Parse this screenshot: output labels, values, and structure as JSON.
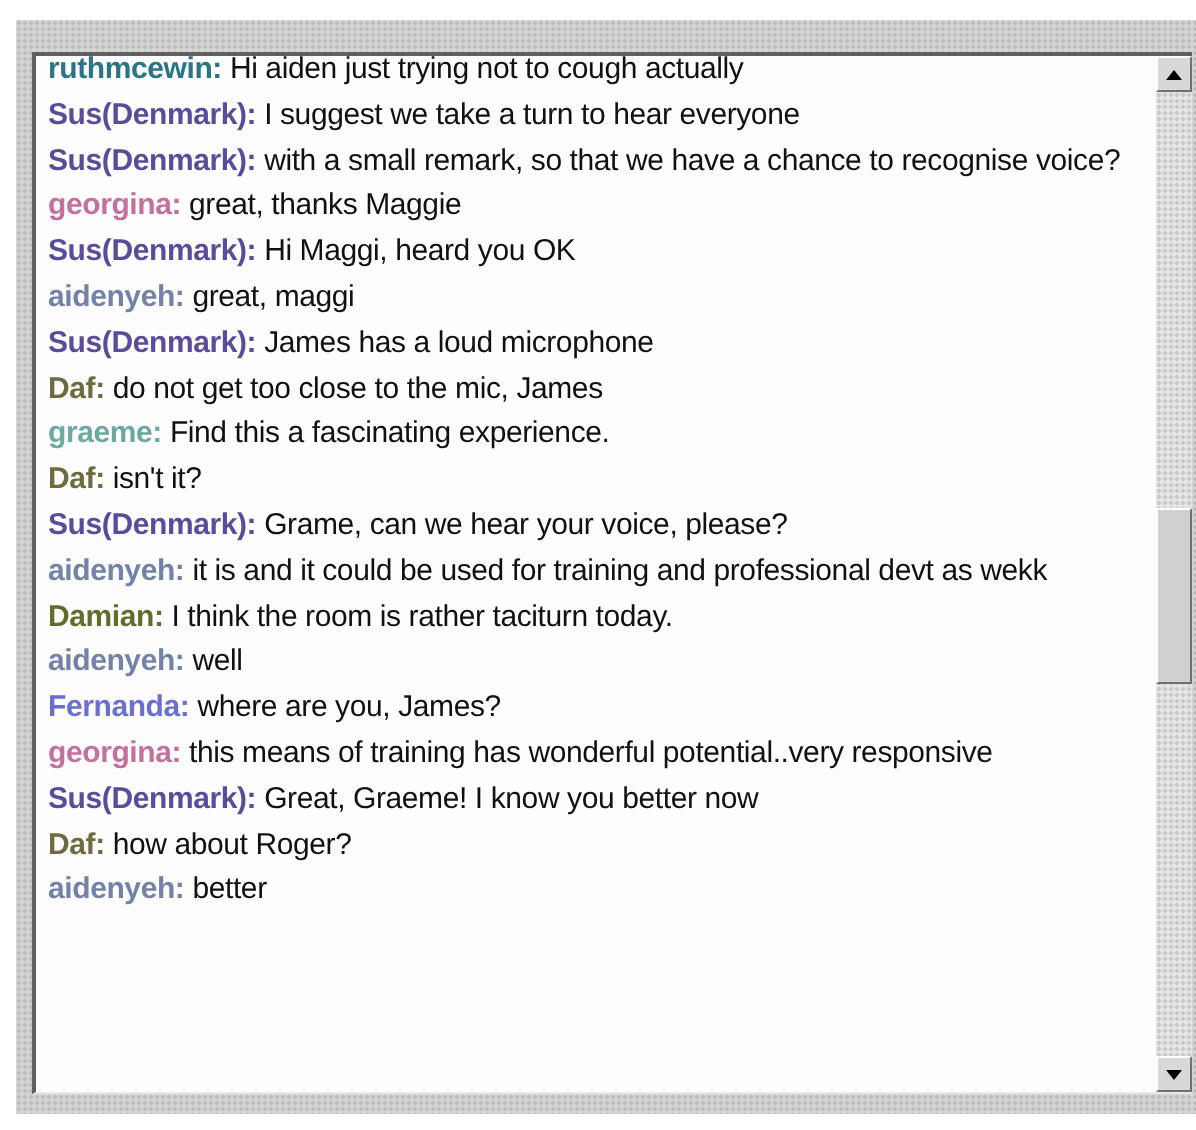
{
  "messages": [
    {
      "speaker": "ruthmcewin:",
      "color": "#2b7488",
      "text": "Hi aiden just trying not to cough actually"
    },
    {
      "speaker": "Sus(Denmark):",
      "color": "#5b4b9b",
      "text": "I suggest we take a turn to hear everyone"
    },
    {
      "speaker": "Sus(Denmark):",
      "color": "#5b4b9b",
      "text": "with a small remark, so that we have a chance to recognise voice?"
    },
    {
      "speaker": "georgina:",
      "color": "#c3709f",
      "text": "great, thanks Maggie"
    },
    {
      "speaker": "Sus(Denmark):",
      "color": "#5b4b9b",
      "text": "Hi Maggi, heard you OK"
    },
    {
      "speaker": "aidenyeh:",
      "color": "#7382a8",
      "text": "great, maggi"
    },
    {
      "speaker": "Sus(Denmark):",
      "color": "#5b4b9b",
      "text": "James has a loud microphone"
    },
    {
      "speaker": "Daf:",
      "color": "#6e6c3e",
      "text": "do not get too close to the mic, James"
    },
    {
      "speaker": "graeme:",
      "color": "#6ea9a0",
      "text": "Find this a fascinating experience."
    },
    {
      "speaker": "Daf:",
      "color": "#6e6c3e",
      "text": "isn't it?"
    },
    {
      "speaker": "Sus(Denmark):",
      "color": "#5b4b9b",
      "text": "Grame, can we hear your voice, please?"
    },
    {
      "speaker": "aidenyeh:",
      "color": "#7382a8",
      "text": "it is and it could be used for training and professional devt as wekk"
    },
    {
      "speaker": "Damian:",
      "color": "#5e6e2c",
      "text": "I think the room is rather taciturn today."
    },
    {
      "speaker": "aidenyeh:",
      "color": "#7382a8",
      "text": "well"
    },
    {
      "speaker": "Fernanda:",
      "color": "#6a6fd0",
      "text": "where are you, James?"
    },
    {
      "speaker": "georgina:",
      "color": "#c3709f",
      "text": "this means of training has wonderful potential..very responsive"
    },
    {
      "speaker": "Sus(Denmark):",
      "color": "#5b4b9b",
      "text": "Great, Graeme! I know you better now"
    },
    {
      "speaker": "Daf:",
      "color": "#6e6c3e",
      "text": "how about Roger?"
    },
    {
      "speaker": "aidenyeh:",
      "color": "#7382a8",
      "text": "better"
    }
  ]
}
